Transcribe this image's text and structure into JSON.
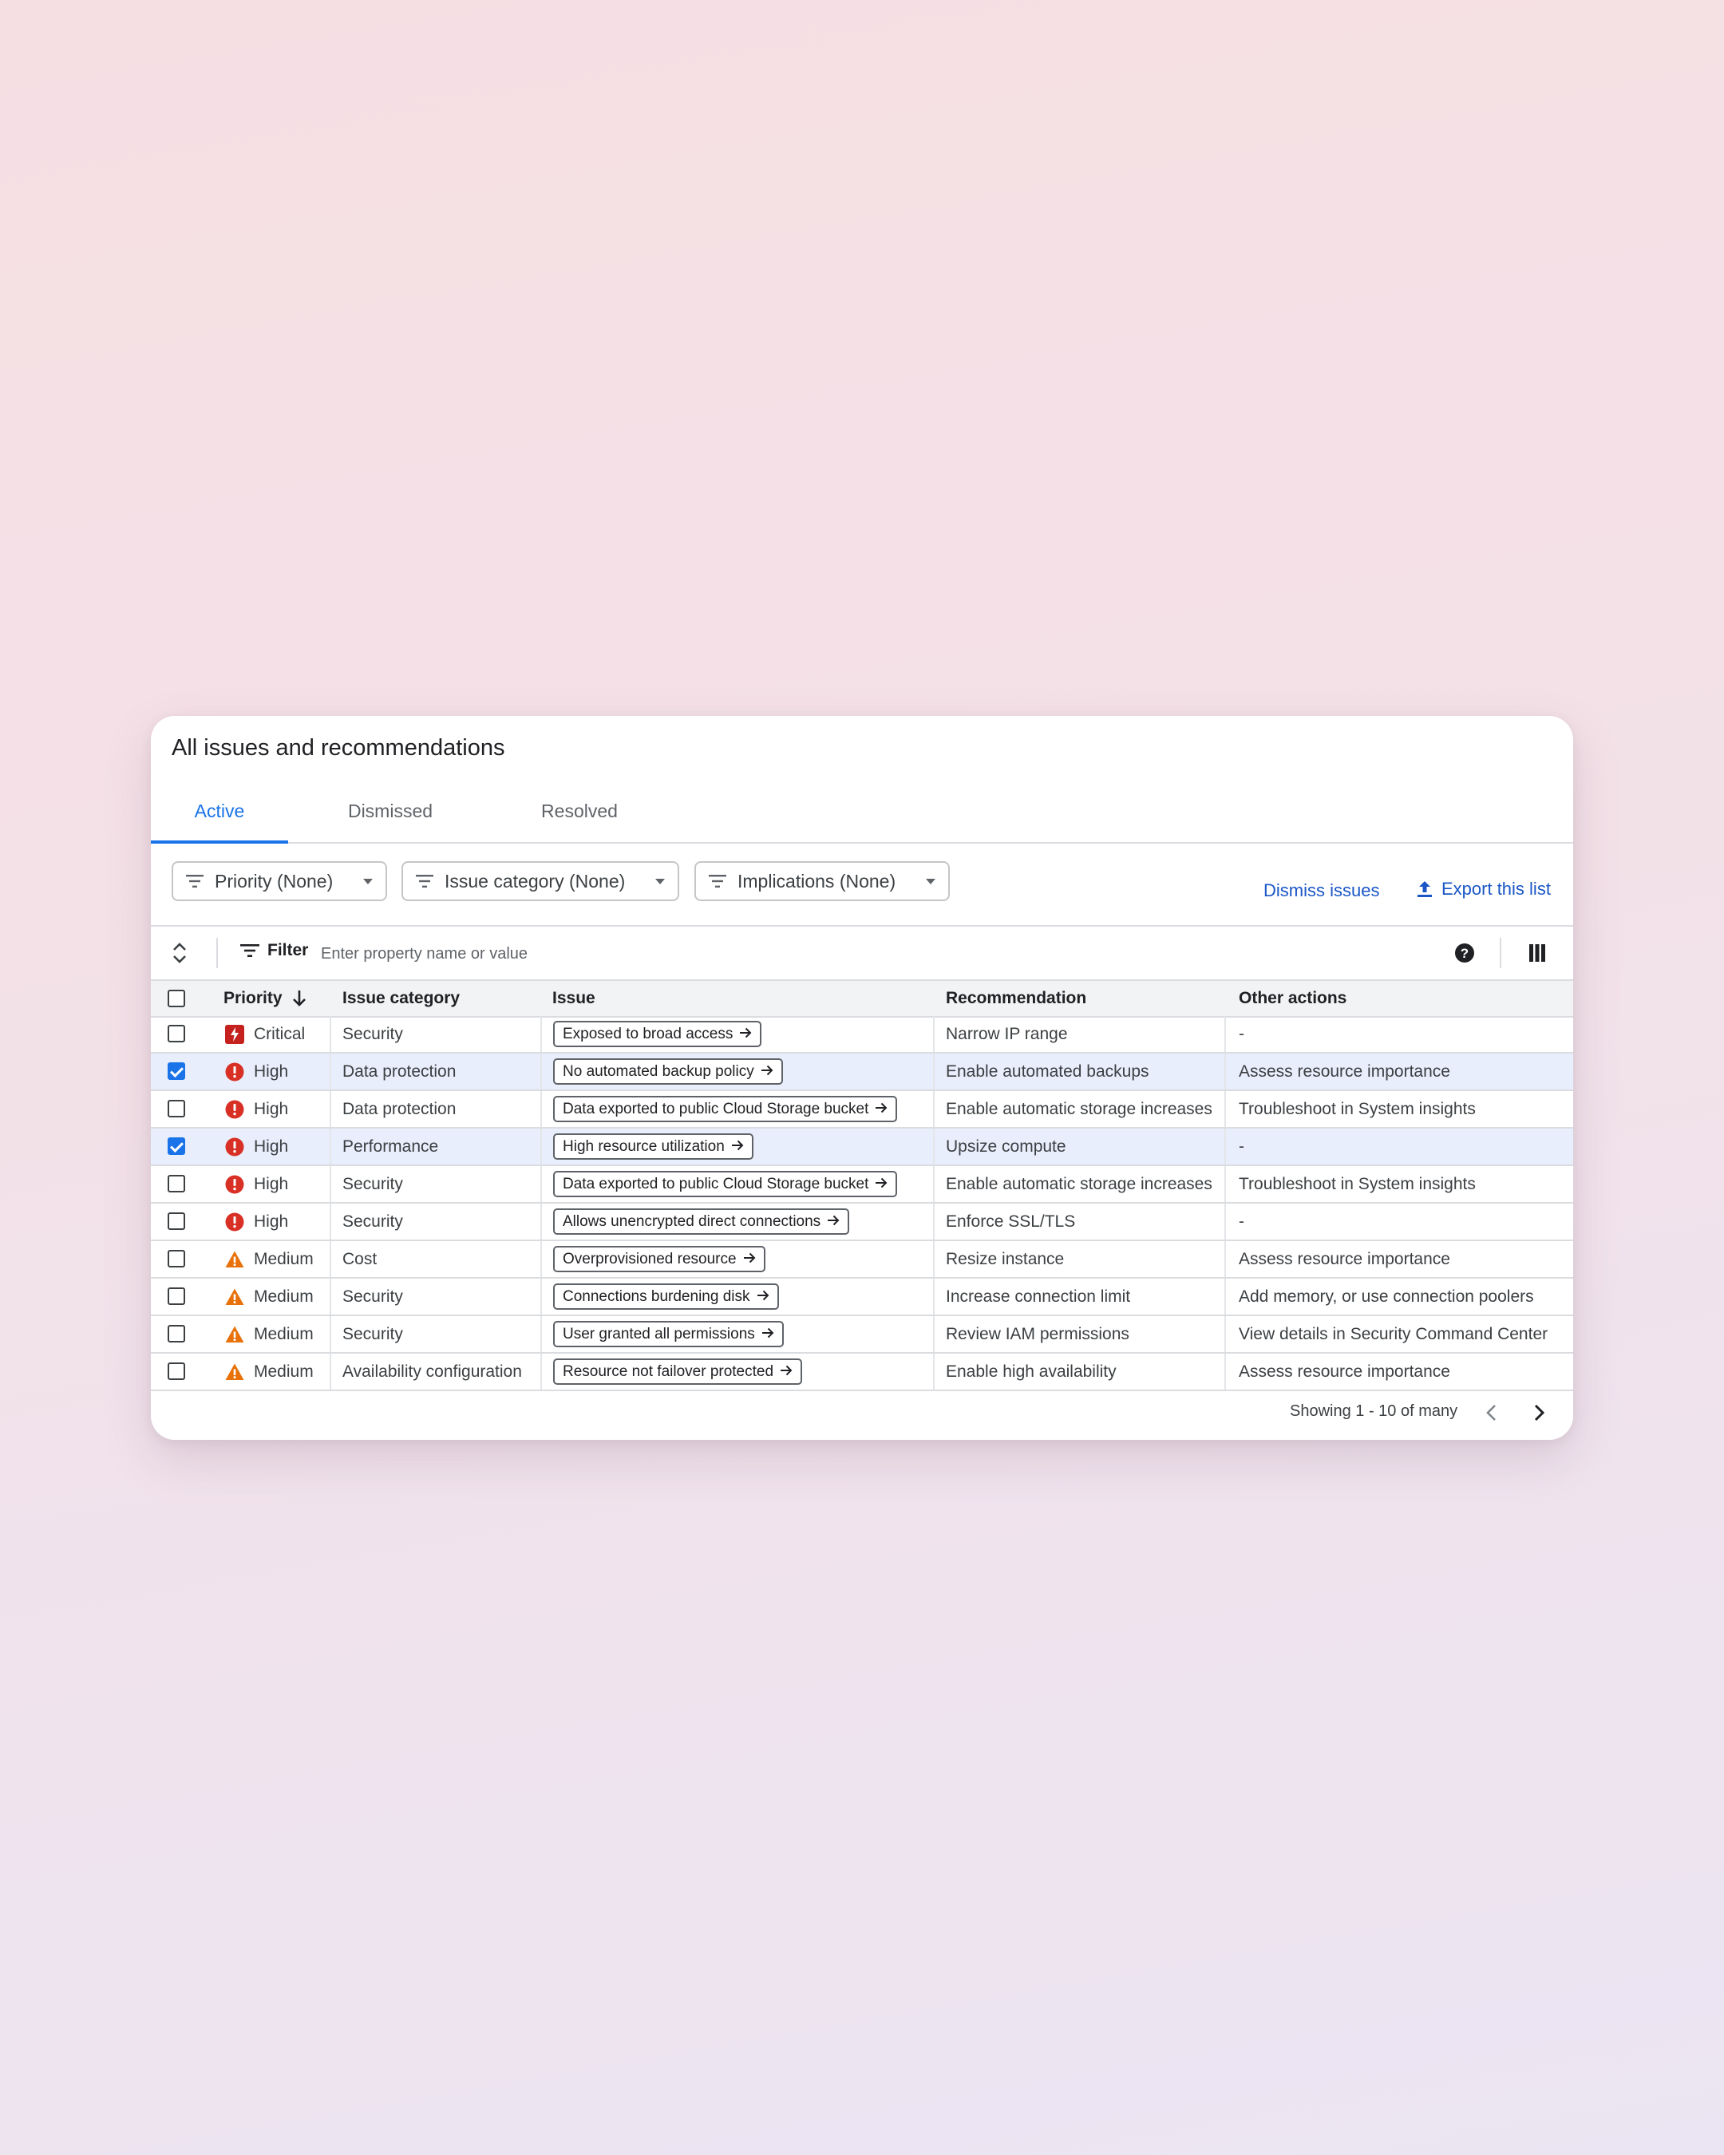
{
  "card": {
    "title": "All issues and recommendations"
  },
  "tabs": [
    {
      "label": "Active",
      "active": true
    },
    {
      "label": "Dismissed",
      "active": false
    },
    {
      "label": "Resolved",
      "active": false
    }
  ],
  "toolbar": {
    "chips": [
      {
        "label": "Priority (None)"
      },
      {
        "label": "Issue category (None)"
      },
      {
        "label": "Implications (None)"
      }
    ],
    "dismiss_label": "Dismiss issues",
    "export_label": "Export this list"
  },
  "filterbar": {
    "filter_label": "Filter",
    "placeholder": "Enter property name or value"
  },
  "table": {
    "headers": {
      "priority": "Priority",
      "category": "Issue category",
      "issue": "Issue",
      "recommendation": "Recommendation",
      "other": "Other actions"
    },
    "rows": [
      {
        "checked": false,
        "priority": "Critical",
        "priority_icon": "critical-icon",
        "category": "Security",
        "issue": "Exposed to broad access",
        "recommendation": "Narrow IP range",
        "other": "-"
      },
      {
        "checked": true,
        "priority": "High",
        "priority_icon": "error-icon",
        "category": "Data protection",
        "issue": "No automated backup policy",
        "recommendation": "Enable automated backups",
        "other": "Assess resource importance"
      },
      {
        "checked": false,
        "priority": "High",
        "priority_icon": "error-icon",
        "category": "Data protection",
        "issue": "Data exported to public Cloud Storage bucket",
        "recommendation": "Enable automatic storage increases",
        "other": "Troubleshoot in System insights"
      },
      {
        "checked": true,
        "priority": "High",
        "priority_icon": "error-icon",
        "category": "Performance",
        "issue": "High resource utilization",
        "recommendation": "Upsize compute",
        "other": "-"
      },
      {
        "checked": false,
        "priority": "High",
        "priority_icon": "error-icon",
        "category": "Security",
        "issue": "Data exported to public Cloud Storage bucket",
        "recommendation": "Enable automatic storage increases",
        "other": "Troubleshoot in System insights"
      },
      {
        "checked": false,
        "priority": "High",
        "priority_icon": "error-icon",
        "category": "Security",
        "issue": "Allows unencrypted direct connections",
        "recommendation": "Enforce SSL/TLS",
        "other": "-"
      },
      {
        "checked": false,
        "priority": "Medium",
        "priority_icon": "warning-icon",
        "category": "Cost",
        "issue": "Overprovisioned resource",
        "recommendation": "Resize instance",
        "other": "Assess resource importance"
      },
      {
        "checked": false,
        "priority": "Medium",
        "priority_icon": "warning-icon",
        "category": "Security",
        "issue": "Connections burdening disk",
        "recommendation": "Increase connection limit",
        "other": "Add memory, or use connection poolers"
      },
      {
        "checked": false,
        "priority": "Medium",
        "priority_icon": "warning-icon",
        "category": "Security",
        "issue": "User granted all permissions",
        "recommendation": "Review IAM permissions",
        "other": "View details in Security Command Center"
      },
      {
        "checked": false,
        "priority": "Medium",
        "priority_icon": "warning-icon",
        "category": "Availability configuration",
        "issue": "Resource not failover protected",
        "recommendation": "Enable high availability",
        "other": "Assess resource importance"
      }
    ]
  },
  "pagination": {
    "text": "Showing 1 - 10 of many"
  },
  "colors": {
    "accent": "#1a73e8",
    "critical": "#c5221f",
    "high": "#d93025",
    "medium": "#e37400",
    "selected_row": "#e8eefc"
  }
}
